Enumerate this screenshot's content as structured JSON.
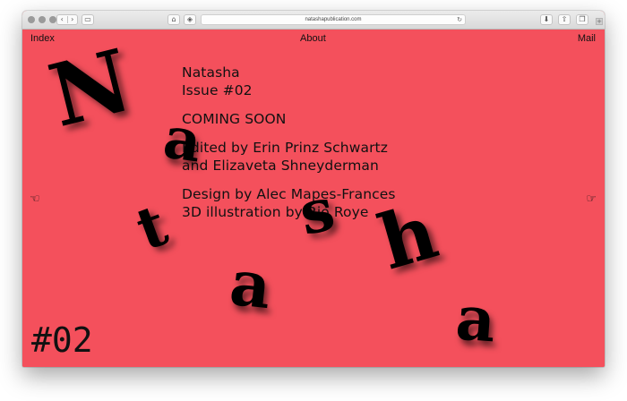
{
  "browser": {
    "url": "natashapublication.com",
    "icons": [
      "back-icon",
      "forward-icon",
      "sidebar-icon",
      "home-icon",
      "shield-icon",
      "reload-icon",
      "download-icon",
      "share-icon",
      "tabs-icon",
      "new-tab-icon"
    ]
  },
  "nav": {
    "left": "Index",
    "center": "About",
    "right": "Mail"
  },
  "arrows": {
    "left": "☜",
    "right": "☞"
  },
  "info": {
    "title": "Natasha",
    "issue": "Issue #02",
    "status": "COMING SOON",
    "edited_1": "Edited by Erin Prinz Schwartz",
    "edited_2": "and Elizaveta Shneyderman",
    "design": "Design by Alec Mapes-Frances",
    "illustration": "3D illustration by Rio Roye"
  },
  "issue_number": "#02",
  "floating_letters": [
    "N",
    "a",
    "t",
    "a",
    "s",
    "h",
    "a"
  ],
  "colors": {
    "background": "#f4505c",
    "text": "#111111"
  }
}
